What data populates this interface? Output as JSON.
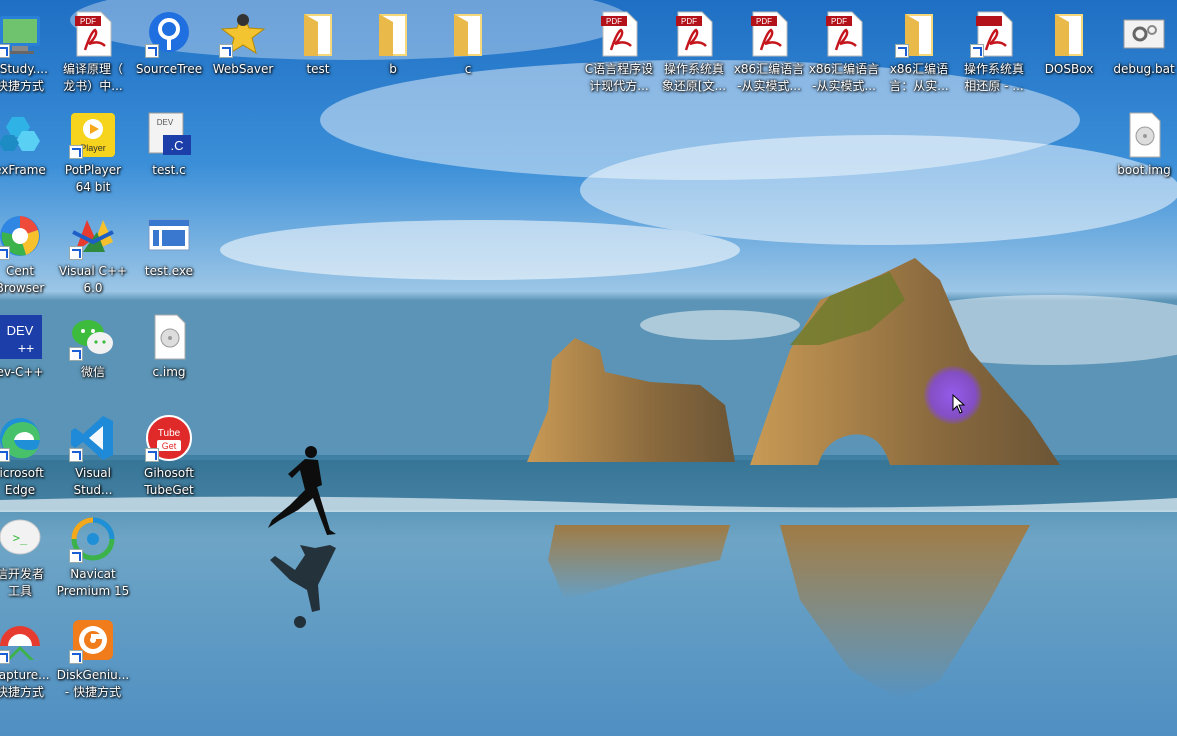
{
  "desktop": {
    "icons": [
      {
        "lines": [
          "pStudy....",
          "快捷方式"
        ],
        "icon": "phpstudy-icon"
      },
      {
        "lines": [
          "编译原理（",
          "龙书）中..."
        ],
        "icon": "pdf-icon"
      },
      {
        "lines": [
          "SourceTree"
        ],
        "icon": "sourcetree-icon"
      },
      {
        "lines": [
          "WebSaver"
        ],
        "icon": "websaver-icon"
      },
      {
        "lines": [
          "test"
        ],
        "icon": "folder-icon"
      },
      {
        "lines": [
          "b"
        ],
        "icon": "folder-icon"
      },
      {
        "lines": [
          "c"
        ],
        "icon": "folder-icon"
      },
      {
        "lines": [
          "C语言程序设",
          "计现代方..."
        ],
        "icon": "pdf-icon"
      },
      {
        "lines": [
          "操作系统真",
          "象还原[文..."
        ],
        "icon": "pdf-icon"
      },
      {
        "lines": [
          "x86汇编语言",
          "-从实模式..."
        ],
        "icon": "pdf-icon"
      },
      {
        "lines": [
          "x86汇编语言",
          "-从实模式..."
        ],
        "icon": "pdf-icon"
      },
      {
        "lines": [
          "x86汇编语",
          "言：从实..."
        ],
        "icon": "folder-icon"
      },
      {
        "lines": [
          "操作系统真",
          "相还原 - ..."
        ],
        "icon": "pdf-icon"
      },
      {
        "lines": [
          "DOSBox"
        ],
        "icon": "folder-icon"
      },
      {
        "lines": [
          "debug.bat"
        ],
        "icon": "bat-icon"
      },
      {
        "lines": [
          "exFrame"
        ],
        "icon": "dexframe-icon"
      },
      {
        "lines": [
          "PotPlayer",
          "64 bit"
        ],
        "icon": "potplayer-icon"
      },
      {
        "lines": [
          "test.c"
        ],
        "icon": "c-file-icon"
      },
      {
        "lines": [
          "boot.img"
        ],
        "icon": "disk-image-icon"
      },
      {
        "lines": [
          "Cent",
          "Browser"
        ],
        "icon": "centbrowser-icon"
      },
      {
        "lines": [
          "Visual C++",
          "6.0"
        ],
        "icon": "visual-cpp-icon"
      },
      {
        "lines": [
          "test.exe"
        ],
        "icon": "exe-icon"
      },
      {
        "lines": [
          "ev-C++"
        ],
        "icon": "devcpp-icon"
      },
      {
        "lines": [
          "微信"
        ],
        "icon": "wechat-icon"
      },
      {
        "lines": [
          "c.img"
        ],
        "icon": "disk-image-icon"
      },
      {
        "lines": [
          "licrosoft",
          "Edge"
        ],
        "icon": "edge-icon"
      },
      {
        "lines": [
          "Visual",
          "Stud..."
        ],
        "icon": "vscode-icon"
      },
      {
        "lines": [
          "Gihosoft",
          "TubeGet"
        ],
        "icon": "tubeget-icon"
      },
      {
        "lines": [
          "信开发者",
          "工具"
        ],
        "icon": "wechat-devtools-icon"
      },
      {
        "lines": [
          "Navicat",
          "Premium 15"
        ],
        "icon": "navicat-icon"
      },
      {
        "lines": [
          "Capture...",
          "快捷方式"
        ],
        "icon": "capture-icon"
      },
      {
        "lines": [
          "DiskGeniu...",
          "- 快捷方式"
        ],
        "icon": "diskgenius-icon"
      }
    ]
  }
}
